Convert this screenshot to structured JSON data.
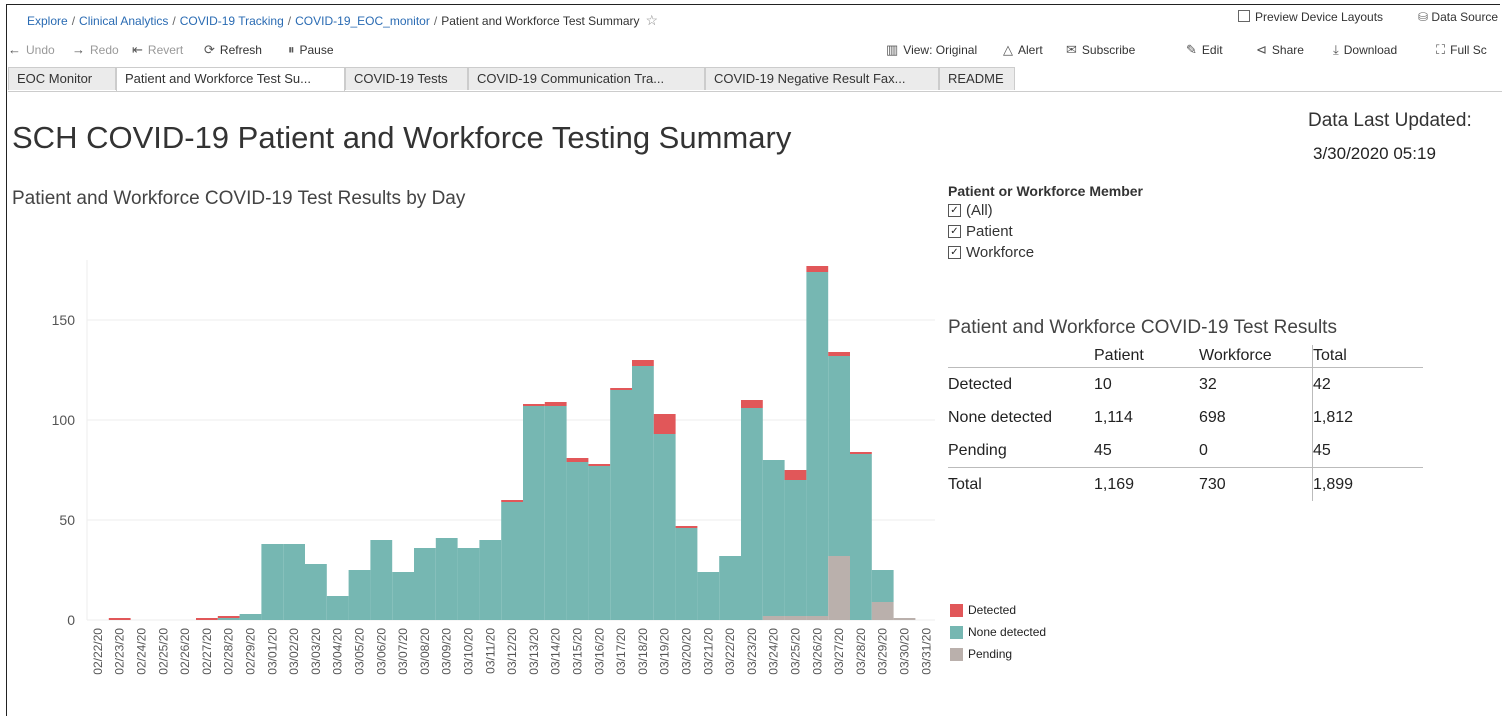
{
  "breadcrumb": {
    "items": [
      "Explore",
      "Clinical Analytics",
      "COVID-19 Tracking",
      "COVID-19_EOC_monitor"
    ],
    "current": "Patient and Workforce Test Summary"
  },
  "top_right": {
    "preview": "Preview Device Layouts",
    "data_source": "Data Source"
  },
  "toolbar": {
    "undo": "Undo",
    "redo": "Redo",
    "revert": "Revert",
    "refresh": "Refresh",
    "pause": "Pause",
    "view": "View: Original",
    "alert": "Alert",
    "subscribe": "Subscribe",
    "edit": "Edit",
    "share": "Share",
    "download": "Download",
    "fullscreen": "Full Sc"
  },
  "tabs": [
    "EOC Monitor",
    "Patient and Workforce Test Su...",
    "COVID-19 Tests",
    "COVID-19 Communication Tra...",
    "COVID-19 Negative Result Fax...",
    "README"
  ],
  "page": {
    "title": "SCH COVID-19 Patient and Workforce Testing Summary",
    "subtitle": "Patient and Workforce COVID-19 Test Results by Day",
    "updated_label": "Data Last Updated:",
    "updated_value": "3/30/2020 05:19"
  },
  "filter": {
    "title": "Patient or Workforce Member",
    "options": [
      "(All)",
      "Patient",
      "Workforce"
    ]
  },
  "results": {
    "title": "Patient and Workforce COVID-19 Test Results",
    "headers": [
      "",
      "Patient",
      "Workforce",
      "Total"
    ],
    "rows": [
      [
        "Detected",
        "10",
        "32",
        "42"
      ],
      [
        "None detected",
        "1,114",
        "698",
        "1,812"
      ],
      [
        "Pending",
        "45",
        "0",
        "45"
      ],
      [
        "Total",
        "1,169",
        "730",
        "1,899"
      ]
    ]
  },
  "colors": {
    "detected": "#e15759",
    "none_detected": "#76b7b2",
    "pending": "#bab0ac"
  },
  "chart_data": {
    "type": "bar",
    "stacked": true,
    "categories": [
      "02/22/20",
      "02/23/20",
      "02/24/20",
      "02/25/20",
      "02/26/20",
      "02/27/20",
      "02/28/20",
      "02/29/20",
      "03/01/20",
      "03/02/20",
      "03/03/20",
      "03/04/20",
      "03/05/20",
      "03/06/20",
      "03/07/20",
      "03/08/20",
      "03/09/20",
      "03/10/20",
      "03/11/20",
      "03/12/20",
      "03/13/20",
      "03/14/20",
      "03/15/20",
      "03/16/20",
      "03/17/20",
      "03/18/20",
      "03/19/20",
      "03/20/20",
      "03/21/20",
      "03/22/20",
      "03/23/20",
      "03/24/20",
      "03/25/20",
      "03/26/20",
      "03/27/20",
      "03/28/20",
      "03/29/20",
      "03/30/20",
      "03/31/20"
    ],
    "series": [
      {
        "name": "Pending",
        "values": [
          0,
          0,
          0,
          0,
          0,
          0,
          0,
          0,
          0,
          0,
          0,
          0,
          0,
          0,
          0,
          0,
          0,
          0,
          0,
          0,
          0,
          0,
          0,
          0,
          0,
          0,
          0,
          0,
          0,
          0,
          0,
          2,
          2,
          2,
          32,
          0,
          9,
          1,
          0
        ]
      },
      {
        "name": "None detected",
        "values": [
          0,
          0,
          0,
          0,
          0,
          0,
          1,
          3,
          38,
          38,
          28,
          12,
          25,
          40,
          24,
          36,
          41,
          36,
          40,
          59,
          107,
          107,
          79,
          77,
          115,
          127,
          93,
          46,
          24,
          32,
          106,
          78,
          68,
          172,
          100,
          83,
          16,
          0,
          0
        ]
      },
      {
        "name": "Detected",
        "values": [
          0,
          1,
          0,
          0,
          0,
          1,
          1,
          0,
          0,
          0,
          0,
          0,
          0,
          0,
          0,
          0,
          0,
          0,
          0,
          1,
          1,
          2,
          2,
          1,
          1,
          3,
          10,
          1,
          0,
          0,
          4,
          0,
          5,
          3,
          2,
          1,
          0,
          0,
          0
        ]
      }
    ],
    "ylim": [
      0,
      180
    ],
    "yticks": [
      0,
      50,
      100,
      150
    ],
    "legend": [
      "Detected",
      "None detected",
      "Pending"
    ],
    "legend_position": "bottom-right"
  }
}
